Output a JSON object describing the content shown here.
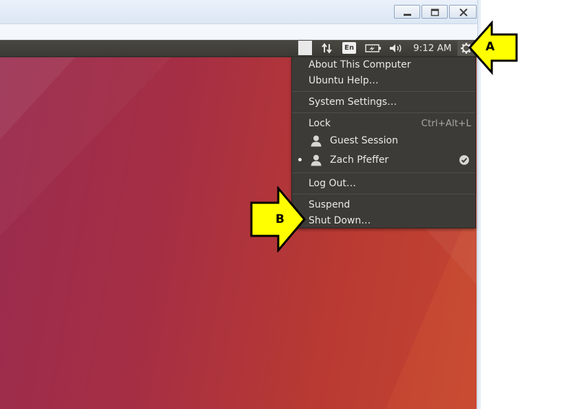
{
  "host_window": {
    "minimize_symbol": "minimize-icon",
    "maximize_symbol": "maximize-icon",
    "close_symbol": "close-icon"
  },
  "panel": {
    "indicators": [
      "network-arrows-icon",
      "keyboard-layout-indicator",
      "battery-icon",
      "volume-icon",
      "gear-icon"
    ],
    "keyboard_layout": "En",
    "clock": "9:12 AM"
  },
  "session_menu": {
    "about": "About This Computer",
    "help": "Ubuntu Help…",
    "settings": "System Settings…",
    "lock": "Lock",
    "lock_shortcut": "Ctrl+Alt+L",
    "guest": "Guest Session",
    "user": "Zach Pfeffer",
    "logout": "Log Out…",
    "suspend": "Suspend",
    "shutdown": "Shut Down…"
  },
  "callouts": {
    "a": "A",
    "b": "B"
  },
  "colors": {
    "panel": "#3b3a35",
    "menu": "#3c3b37",
    "callout_fill": "#ffff00",
    "desktop_start": "#9a2c4f",
    "desktop_end": "#c34531"
  }
}
